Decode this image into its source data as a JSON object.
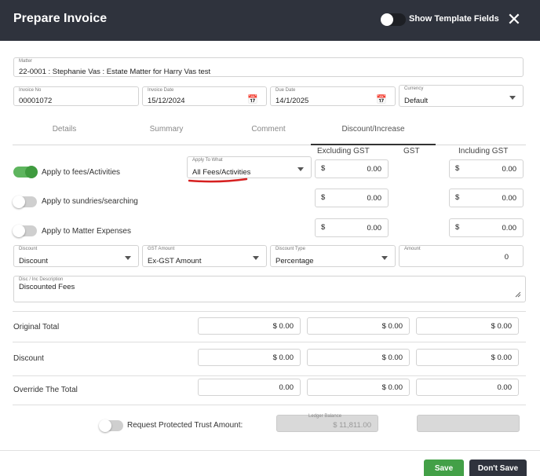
{
  "header": {
    "title": "Prepare Invoice",
    "template_toggle_label": "Show Template Fields",
    "template_toggle_on": false
  },
  "matter": {
    "label": "Matter",
    "value": "22-0001 : Stephanie Vas : Estate Matter for Harry Vas test"
  },
  "invoice_no": {
    "label": "Invoice No",
    "value": "00001072"
  },
  "invoice_date": {
    "label": "Invoice Date",
    "value": "15/12/2024"
  },
  "due_date": {
    "label": "Due Date",
    "value": "14/1/2025"
  },
  "currency": {
    "label": "Currency",
    "value": "Default"
  },
  "tabs": [
    {
      "label": "Details",
      "active": false
    },
    {
      "label": "Summary",
      "active": false
    },
    {
      "label": "Comment",
      "active": false
    },
    {
      "label": "Discount/Increase",
      "active": true
    }
  ],
  "columns": {
    "excl_gst": "Excluding GST",
    "gst": "GST",
    "incl_gst": "Including GST"
  },
  "apply_to_what": {
    "label": "Apply To What",
    "value": "All Fees/Activities"
  },
  "apply_rows": [
    {
      "label": "Apply to fees/Activities",
      "on": true,
      "excl_currency": "$",
      "excl_amount": "0.00",
      "incl_currency": "$",
      "incl_amount": "0.00"
    },
    {
      "label": "Apply to sundries/searching",
      "on": false,
      "excl_currency": "$",
      "excl_amount": "0.00",
      "incl_currency": "$",
      "incl_amount": "0.00"
    },
    {
      "label": "Apply to Matter Expenses",
      "on": false,
      "excl_currency": "$",
      "excl_amount": "0.00",
      "incl_currency": "$",
      "incl_amount": "0.00"
    }
  ],
  "discount": {
    "label": "Discount",
    "value": "Discount"
  },
  "gst_amount": {
    "label": "GST Amount",
    "value": "Ex-GST Amount"
  },
  "discount_type": {
    "label": "Discount Type",
    "value": "Percentage"
  },
  "amount": {
    "label": "Amount",
    "value": "0"
  },
  "description": {
    "label": "Disc / Inc Description",
    "value": "Discounted Fees"
  },
  "totals": [
    {
      "label": "Original Total",
      "excl": "$ 0.00",
      "gst": "$ 0.00",
      "incl": "$ 0.00"
    },
    {
      "label": "Discount",
      "excl": "$ 0.00",
      "gst": "$ 0.00",
      "incl": "$ 0.00"
    },
    {
      "label": "Override The Total",
      "excl": "0.00",
      "gst": "$ 0.00",
      "incl": "0.00"
    }
  ],
  "trust": {
    "toggle_label": "Request Protected Trust Amount:",
    "on": false,
    "ledger_label": "Ledger Balance",
    "ledger_value": "$ 11,811.00"
  },
  "buttons": {
    "save": "Save",
    "dont_save": "Don't Save"
  },
  "colors": {
    "header_bg": "#2f333d",
    "toggle_on": "#3f9b3f",
    "save_button": "#43a047",
    "annotation_underline": "#d62020"
  },
  "icons": [
    "close-icon",
    "calendar-icon",
    "chevron-down-icon",
    "resize-handle-icon"
  ]
}
